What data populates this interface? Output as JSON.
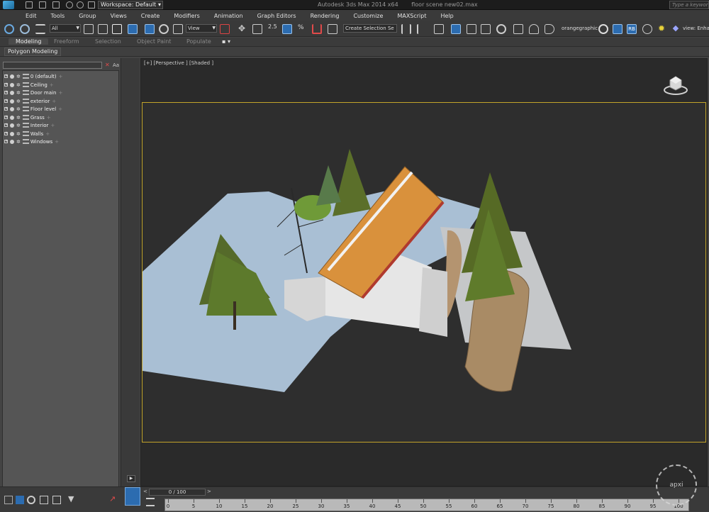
{
  "titlebar": {
    "workspace": "Workspace: Default",
    "app_title": "Autodesk 3ds Max  2014 x64",
    "file_name": "floor scene new02.max",
    "search_placeholder": "Type a keyword or phrase"
  },
  "menu": {
    "items": [
      "Edit",
      "Tools",
      "Group",
      "Views",
      "Create",
      "Modifiers",
      "Animation",
      "Graph Editors",
      "Rendering",
      "Customize",
      "MAXScript",
      "Help"
    ]
  },
  "toolbar": {
    "filter_value": "All",
    "refcoord_value": "View",
    "selection_set_placeholder": "Create Selection Se",
    "snap_value": "2.5",
    "orangegraphic_label": "orangegraphic",
    "rb_label": "RB",
    "view_enh_label": "view: Enhan"
  },
  "ribbon": {
    "tabs": [
      "Modeling",
      "Freeform",
      "Selection",
      "Object Paint",
      "Populate"
    ],
    "panel_label": "Polygon Modeling"
  },
  "explorer": {
    "clear_label": "✕",
    "aa_label": "Aa",
    "layers": [
      {
        "label": "0 (default)"
      },
      {
        "label": "Ceiling"
      },
      {
        "label": "Door main"
      },
      {
        "label": "exterior"
      },
      {
        "label": "Floor level"
      },
      {
        "label": "Grass"
      },
      {
        "label": "Interior"
      },
      {
        "label": "Walls"
      },
      {
        "label": "Windows"
      }
    ]
  },
  "viewport": {
    "label": "[+] [Perspective ] [Shaded ]"
  },
  "timeline": {
    "frame_counter": "0 / 100",
    "ticks": [
      "0",
      "5",
      "10",
      "15",
      "20",
      "25",
      "30",
      "35",
      "40",
      "45",
      "50",
      "55",
      "60",
      "65",
      "70",
      "75",
      "80",
      "85",
      "90",
      "95",
      "100"
    ]
  },
  "colors": {
    "accent_blue": "#2c6cb0",
    "viewport_border": "#c2a42a",
    "roof": "#d9913c",
    "ground": "#a9bfd4",
    "rock": "#a98b65"
  }
}
